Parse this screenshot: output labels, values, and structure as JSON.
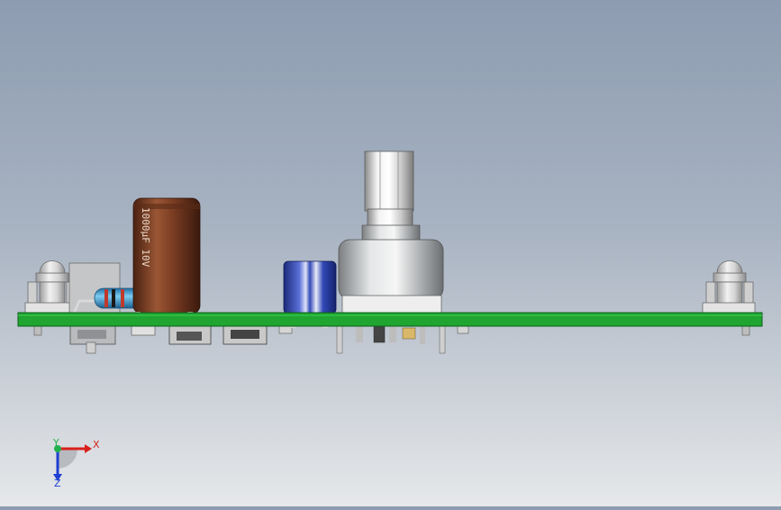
{
  "viewport": {
    "background_top": "#8d9cb1",
    "background_bottom": "#e6e8ea"
  },
  "pcb": {
    "color": "#1fa530",
    "edge_color": "#0b5e18"
  },
  "components": {
    "electrolytic_cap_brown": {
      "color": "#7a3c22",
      "marking": "1000μF 10V"
    },
    "electrolytic_cap_blue": {
      "color": "#3249b8"
    },
    "resistor": {
      "body_color": "#3aa2d8",
      "bands": [
        "#c0392b",
        "#1a1a1a",
        "#c0392b",
        "#d4af37"
      ]
    },
    "potentiometer": {
      "color": "#c9cbcb",
      "shaft_color": "#e8e8e8"
    },
    "standoffs": {
      "color": "#d9d9d9"
    }
  },
  "triad": {
    "x_label": "X",
    "y_label": "Y",
    "z_label": "Z",
    "x_color": "#d8201c",
    "y_color": "#22b14c",
    "z_color": "#1f3fd1"
  }
}
